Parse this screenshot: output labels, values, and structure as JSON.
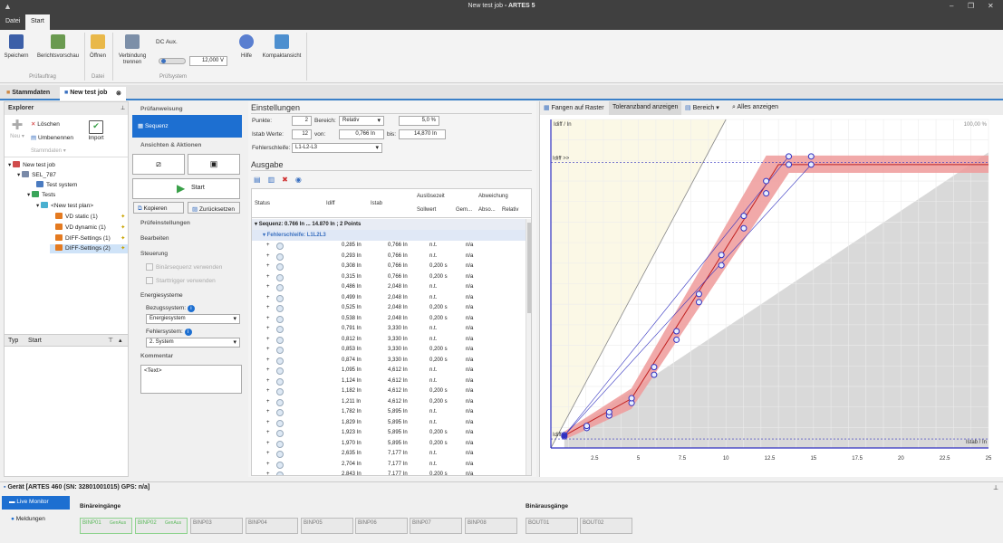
{
  "app": {
    "title_a": "New test job",
    "title_b": " - ARTES 5"
  },
  "menu": {
    "file": "Datei",
    "start": "Start"
  },
  "ribbon": {
    "save": "Speichern",
    "report_preview": "Berichtsvorschau",
    "open": "Öffnen",
    "disconnect_a": "Verbindung",
    "disconnect_b": "trennen",
    "dc_aux": "DC Aux.",
    "dc_value": "12,000 V",
    "help": "Hilfe",
    "compact": "Kompaktansicht",
    "grp_testorder": "Prüfauftrag",
    "grp_file": "Datei",
    "grp_testsystem": "Prüfsystem"
  },
  "tabs": {
    "master": "Stammdaten",
    "job": "New test job"
  },
  "explorer": {
    "title": "Explorer",
    "delete": "Löschen",
    "rename": "Umbenennen",
    "new": "Neu",
    "master": "Stammdaten",
    "import": "Import",
    "tree": [
      "New test job",
      "SEL_787",
      "Test system",
      "Tests",
      "<New test plan>",
      "VD static (1)",
      "VD dynamic (1)",
      "DIFF-Settings (1)",
      "DIFF-Settings (2)"
    ],
    "col_type": "Typ",
    "col_start": "Start"
  },
  "middle": {
    "test_instruction": "Prüfanweisung",
    "sequence": "Sequenz",
    "views_actions": "Ansichten & Aktionen",
    "start": "Start",
    "copy": "Kopieren",
    "reset": "Zurücksetzen",
    "test_settings": "Prüfeinstellungen",
    "edit": "Bearbeiten",
    "control": "Steuerung",
    "binary_seq": "Binärsequenz verwenden",
    "start_trigger": "Starttrigger verwenden",
    "energy_systems": "Energiesysteme",
    "ref_system_label": "Bezugssystem:",
    "ref_system": "Energiesystem",
    "fault_system_label": "Fehlersystem:",
    "fault_system": "2. System",
    "comment": "Kommentar",
    "comment_text": "<Text>"
  },
  "settings": {
    "title": "Einstellungen",
    "points_label": "Punkte:",
    "points": "2",
    "range_label": "Bereich:",
    "range": "Relativ",
    "percent": "5,0 %",
    "istab_label": "Istab Werte:",
    "istab_count": "12",
    "from_label": "von:",
    "from": "0,766 In",
    "to_label": "bis:",
    "to": "14,870 In",
    "loop_label": "Fehlerschleife:",
    "loop": "L1-L2-L3"
  },
  "output": {
    "title": "Ausgabe",
    "h_status": "Status",
    "h_idiff": "Idiff",
    "h_istab": "Istab",
    "h_trip": "Auslösezeit",
    "h_dev": "Abweichung",
    "h_nominal": "Sollwert",
    "h_meas": "Gem...",
    "h_abs": "Abso...",
    "h_rel": "Relativ",
    "group": "Sequenz: 0.766 In ... 14.870 In ; 2 Points",
    "loop": "Fehlerschleife: L1L2L3",
    "rows": [
      [
        "0,285 In",
        "0,766 In",
        "n.t.",
        "n/a"
      ],
      [
        "0,293 In",
        "0,766 In",
        "n.t.",
        "n/a"
      ],
      [
        "0,308 In",
        "0,766 In",
        "0,200 s",
        "n/a"
      ],
      [
        "0,315 In",
        "0,766 In",
        "0,200 s",
        "n/a"
      ],
      [
        "0,486 In",
        "2,048 In",
        "n.t.",
        "n/a"
      ],
      [
        "0,499 In",
        "2,048 In",
        "n.t.",
        "n/a"
      ],
      [
        "0,525 In",
        "2,048 In",
        "0,200 s",
        "n/a"
      ],
      [
        "0,538 In",
        "2,048 In",
        "0,200 s",
        "n/a"
      ],
      [
        "0,791 In",
        "3,330 In",
        "n.t.",
        "n/a"
      ],
      [
        "0,812 In",
        "3,330 In",
        "n.t.",
        "n/a"
      ],
      [
        "0,853 In",
        "3,330 In",
        "0,200 s",
        "n/a"
      ],
      [
        "0,874 In",
        "3,330 In",
        "0,200 s",
        "n/a"
      ],
      [
        "1,095 In",
        "4,612 In",
        "n.t.",
        "n/a"
      ],
      [
        "1,124 In",
        "4,612 In",
        "n.t.",
        "n/a"
      ],
      [
        "1,182 In",
        "4,612 In",
        "0,200 s",
        "n/a"
      ],
      [
        "1,211 In",
        "4,612 In",
        "0,200 s",
        "n/a"
      ],
      [
        "1,782 In",
        "5,895 In",
        "n.t.",
        "n/a"
      ],
      [
        "1,829 In",
        "5,895 In",
        "n.t.",
        "n/a"
      ],
      [
        "1,923 In",
        "5,895 In",
        "0,200 s",
        "n/a"
      ],
      [
        "1,970 In",
        "5,895 In",
        "0,200 s",
        "n/a"
      ],
      [
        "2,635 In",
        "7,177 In",
        "n.t.",
        "n/a"
      ],
      [
        "2,704 In",
        "7,177 In",
        "n.t.",
        "n/a"
      ],
      [
        "2,843 In",
        "7,177 In",
        "0,200 s",
        "n/a"
      ]
    ]
  },
  "chart": {
    "snap": "Fangen auf Raster",
    "tolerance": "Toleranzband anzeigen",
    "range": "Bereich",
    "show_all": "Alles anzeigen",
    "y_axis": "Idiff / In",
    "x_axis": "Istab / In",
    "zoom": "100,00 %",
    "idiff_hi": "Idiff >>",
    "idiff_lo": "Idiff",
    "xticks": [
      "2.5",
      "5",
      "7.5",
      "10",
      "12.5",
      "15",
      "17.5",
      "20",
      "22.5",
      "25"
    ],
    "points": [
      [
        0.766,
        0.285
      ],
      [
        0.766,
        0.315
      ],
      [
        2.048,
        0.486
      ],
      [
        2.048,
        0.538
      ],
      [
        3.33,
        0.791
      ],
      [
        3.33,
        0.874
      ],
      [
        4.612,
        1.095
      ],
      [
        4.612,
        1.211
      ],
      [
        5.895,
        1.782
      ],
      [
        5.895,
        1.97
      ],
      [
        7.177,
        2.635
      ],
      [
        7.177,
        2.843
      ],
      [
        8.46,
        3.55
      ],
      [
        8.46,
        3.75
      ],
      [
        9.74,
        4.45
      ],
      [
        9.74,
        4.7
      ],
      [
        11.02,
        5.35
      ],
      [
        11.02,
        5.65
      ],
      [
        12.3,
        6.2
      ],
      [
        12.3,
        6.5
      ],
      [
        13.59,
        6.9
      ],
      [
        13.59,
        7.1
      ],
      [
        14.87,
        6.9
      ],
      [
        14.87,
        7.1
      ]
    ]
  },
  "device": {
    "title": "Gerät [ARTES 460 (SN: 32801001015) GPS: n/a]",
    "live": "Live Monitor",
    "messages": "Meldungen",
    "bin_in": "Binäreingänge",
    "bin_out": "Binärausgänge",
    "inputs": [
      "BINP01",
      "BINP02",
      "BINP03",
      "BINP04",
      "BINP05",
      "BINP06",
      "BINP07",
      "BINP08"
    ],
    "gen": "GenAus",
    "outputs": [
      "BOUT01",
      "BOUT02"
    ]
  }
}
